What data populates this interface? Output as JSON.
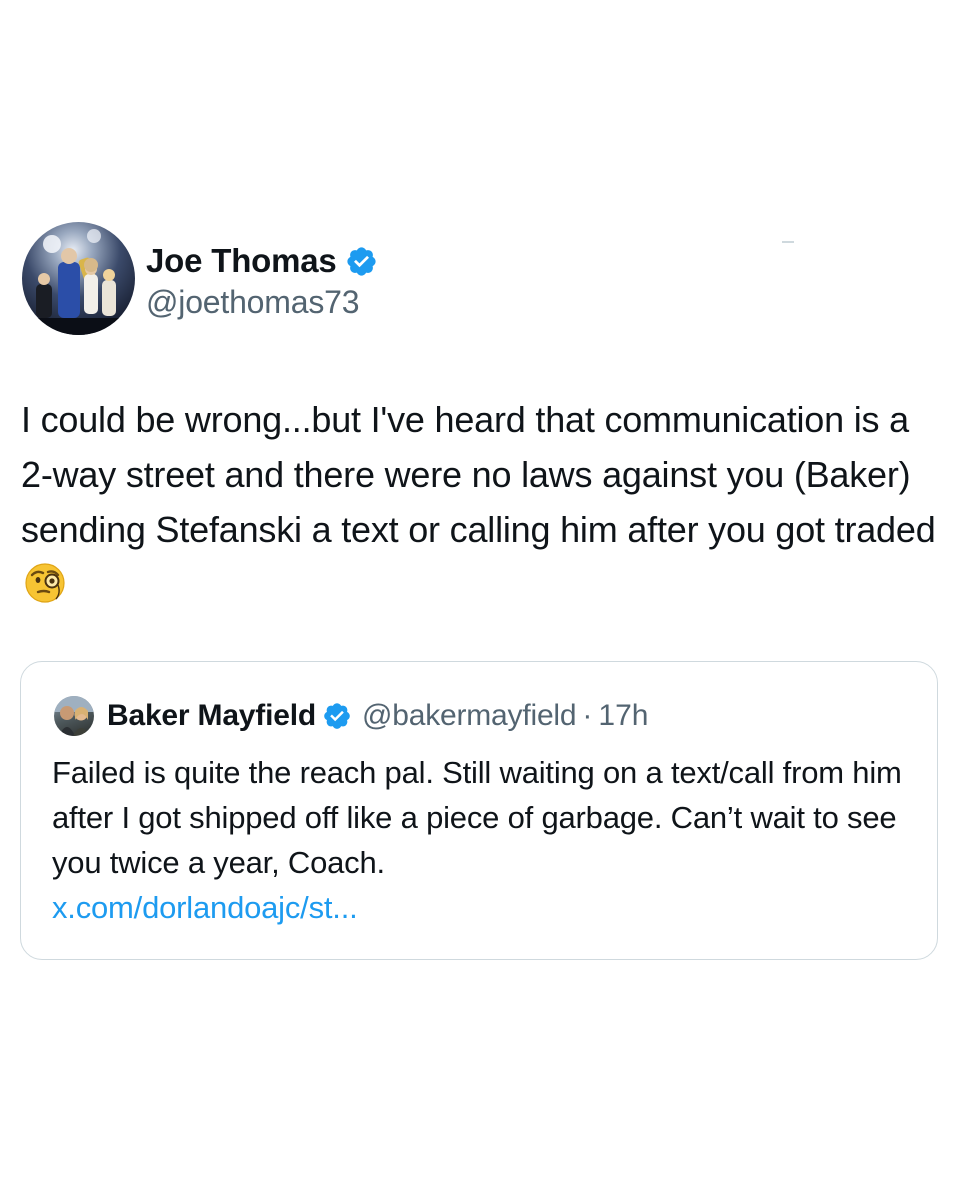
{
  "author": {
    "name": "Joe Thomas",
    "handle": "@joethomas73",
    "avatar_icon": "profile-photo",
    "verified": true
  },
  "tweet": {
    "text": "I could be wrong...but I've heard that communication is a 2-way street and there were no laws against you (Baker) sending Stefanski a text or calling him after you got traded",
    "emoji": "face-with-monocle"
  },
  "quoted_tweet": {
    "author_name": "Baker Mayfield",
    "handle": "@bakermayfield",
    "separator": "·",
    "time": "17h",
    "verified": true,
    "text": "Failed is quite the reach pal. Still waiting on a text/call from him after I got shipped off like a piece of garbage. Can’t wait to see you twice a year, Coach.",
    "link": "x.com/dorlandoajc/st..."
  },
  "colors": {
    "verified_blue": "#1d9bf0",
    "text": "#0f1419",
    "muted": "#536471",
    "border": "#cfd9de"
  }
}
